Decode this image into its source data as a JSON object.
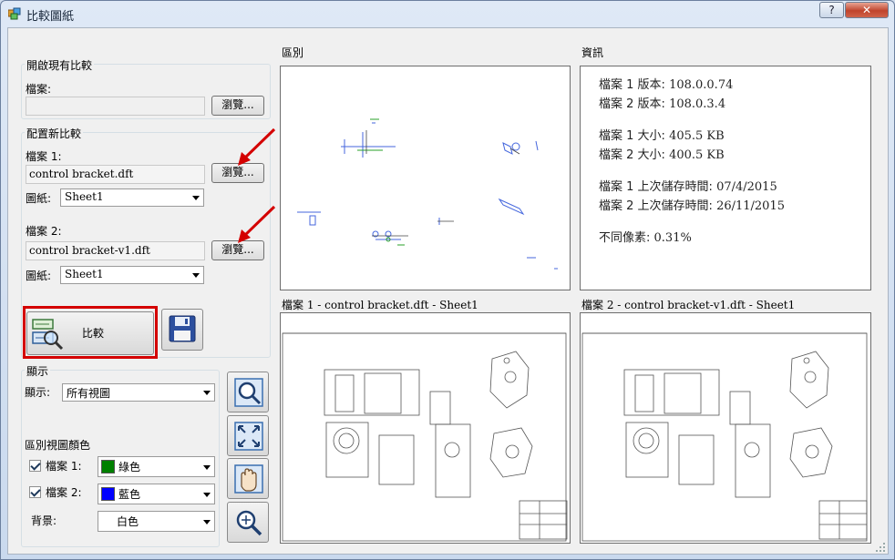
{
  "window": {
    "title": "比較圖紙",
    "help_label": "?",
    "close_label": "✕"
  },
  "open_existing": {
    "caption": "開啟現有比較",
    "file_label": "檔案:",
    "file_value": "",
    "browse_label": "瀏覽..."
  },
  "new_compare": {
    "caption": "配置新比較",
    "file1_label": "檔案 1:",
    "file1_value": "control bracket.dft",
    "file1_browse": "瀏覽...",
    "sheet1_label": "圖紙:",
    "sheet1_value": "Sheet1",
    "file2_label": "檔案 2:",
    "file2_value": "control bracket-v1.dft",
    "file2_browse": "瀏覽...",
    "sheet2_label": "圖紙:",
    "sheet2_value": "Sheet1",
    "compare_label": "比較"
  },
  "display": {
    "caption": "顯示",
    "show_label": "顯示:",
    "show_value": "所有視圖",
    "diff_color_caption": "區別視圖顏色",
    "file1_label": "檔案 1:",
    "file1_color_name": "綠色",
    "file1_color": "#008000",
    "file1_checked": true,
    "file2_label": "檔案 2:",
    "file2_color_name": "藍色",
    "file2_color": "#0000ff",
    "file2_checked": true,
    "background_label": "背景:",
    "background_value": "白色"
  },
  "panels": {
    "diff_title": "區別",
    "info_title": "資訊",
    "sheet1_title": "檔案 1 - control bracket.dft - Sheet1",
    "sheet2_title": "檔案 2 - control bracket-v1.dft - Sheet1"
  },
  "info": {
    "file1_version_label": "檔案 1 版本: ",
    "file1_version": "108.0.0.74",
    "file2_version_label": "檔案 2 版本: ",
    "file2_version": "108.0.3.4",
    "file1_size_label": "檔案 1 大小: ",
    "file1_size": "405.5 KB",
    "file2_size_label": "檔案 2 大小: ",
    "file2_size": "400.5 KB",
    "file1_saved_label": "檔案 1 上次儲存時間: ",
    "file1_saved": "07/4/2015",
    "file2_saved_label": "檔案 2 上次儲存時間: ",
    "file2_saved": "26/11/2015",
    "diff_pixels_label": "不同像素: ",
    "diff_pixels": "0.31%"
  },
  "colors": {
    "accent_red": "#d40000",
    "window_blue": "#c9d9ee"
  },
  "icons": [
    "app-icon",
    "compare-icon",
    "save-icon",
    "zoom-area-icon",
    "fit-icon",
    "pan-icon",
    "zoom-icon",
    "arrow-annotation-icon"
  ]
}
